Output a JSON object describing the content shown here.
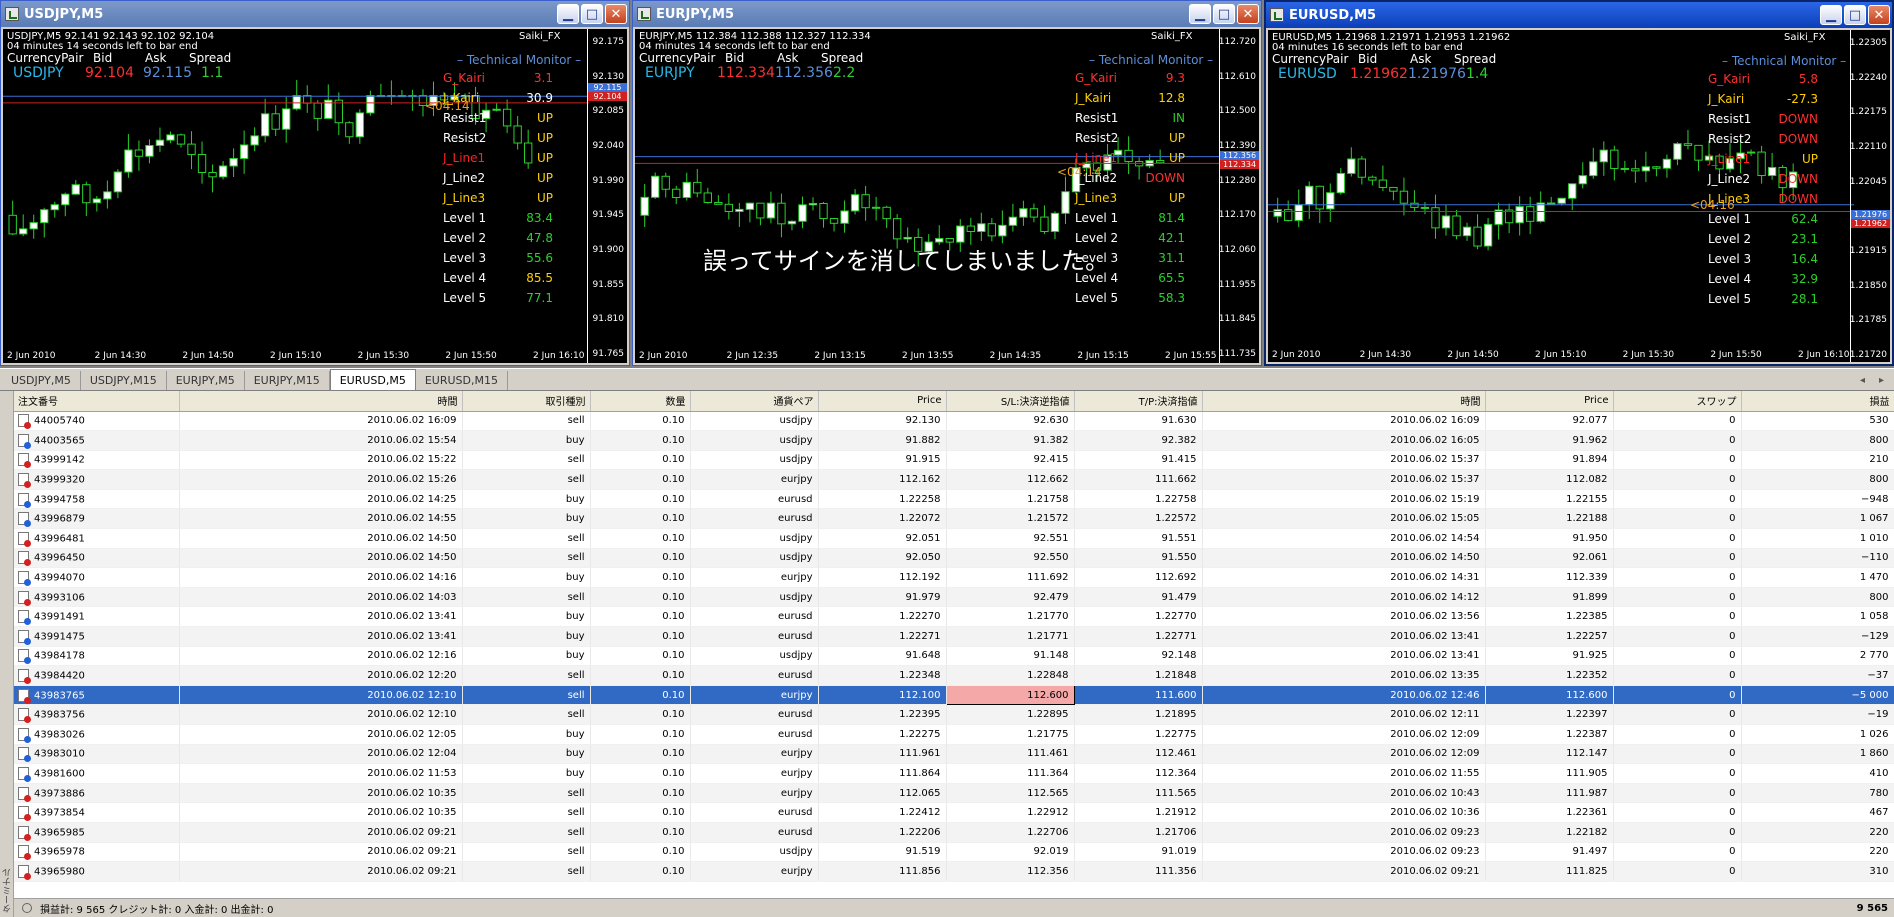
{
  "windows": [
    {
      "id": "w1",
      "title": "USDJPY,M5",
      "info_line1": "USDJPY,M5  92.141 92.143 92.102 92.104",
      "info_line2": "04 minutes 14 seconds left to bar end",
      "brand": "Saiki_FX",
      "hdr": {
        "pair_label": "CurrencyPair",
        "bid_label": "Bid",
        "ask_label": "Ask",
        "spread_label": "Spread",
        "pair": "USDJPY",
        "bid": "92.104",
        "ask": "92.115",
        "spread": "1.1"
      },
      "monitor_title": "– Technical  Monitor –",
      "monitor": [
        {
          "label": "G_Kairi",
          "value": "3.1",
          "lc": "#ff3030",
          "vc": "#ff3030"
        },
        {
          "label": "J_Kairi",
          "value": "30.9",
          "lc": "#ffd000",
          "vc": "#ffffff"
        },
        {
          "label": "Resist1",
          "value": "UP",
          "lc": "#ffffff",
          "vc": "#ffd000"
        },
        {
          "label": "Resist2",
          "value": "UP",
          "lc": "#ffffff",
          "vc": "#ffd000"
        },
        {
          "label": "J_Line1",
          "value": "UP",
          "lc": "#ff2020",
          "vc": "#ffd000"
        },
        {
          "label": "J_Line2",
          "value": "UP",
          "lc": "#ffffff",
          "vc": "#ffd000"
        },
        {
          "label": "J_Line3",
          "value": "UP",
          "lc": "#ffd000",
          "vc": "#ffd000"
        },
        {
          "label": "Level 1",
          "value": "83.4",
          "lc": "#ffffff",
          "vc": "#2bd12b"
        },
        {
          "label": "Level 2",
          "value": "47.8",
          "lc": "#ffffff",
          "vc": "#2bd12b"
        },
        {
          "label": "Level 3",
          "value": "55.6",
          "lc": "#ffffff",
          "vc": "#2bd12b"
        },
        {
          "label": "Level 4",
          "value": "85.5",
          "lc": "#ffffff",
          "vc": "#ffd000"
        },
        {
          "label": "Level 5",
          "value": "77.1",
          "lc": "#ffffff",
          "vc": "#2bd12b"
        }
      ],
      "prices": [
        "92.175",
        "92.130",
        "92.085",
        "92.040",
        "91.990",
        "91.945",
        "91.900",
        "91.855",
        "91.810",
        "91.765"
      ],
      "current_tags": [
        "92.115",
        "92.104"
      ],
      "times": [
        "2 Jun 2010",
        "2 Jun 14:30",
        "2 Jun 14:50",
        "2 Jun 15:10",
        "2 Jun 15:30",
        "2 Jun 15:50",
        "2 Jun 16:10"
      ],
      "countdown": "<04:14",
      "note": ""
    },
    {
      "id": "w2",
      "title": "EURJPY,M5",
      "info_line1": "EURJPY,M5  112.384 112.388 112.327 112.334",
      "info_line2": "04 minutes 14 seconds left to bar end",
      "brand": "Saiki_FX",
      "hdr": {
        "pair_label": "CurrencyPair",
        "bid_label": "Bid",
        "ask_label": "Ask",
        "spread_label": "Spread",
        "pair": "EURJPY",
        "bid": "112.334",
        "ask": "112.356",
        "spread": "2.2"
      },
      "monitor_title": "– Technical  Monitor –",
      "monitor": [
        {
          "label": "G_Kairi",
          "value": "9.3",
          "lc": "#ff3030",
          "vc": "#ff3030"
        },
        {
          "label": "J_Kairi",
          "value": "12.8",
          "lc": "#ffd000",
          "vc": "#ffd000"
        },
        {
          "label": "Resist1",
          "value": "IN",
          "lc": "#ffffff",
          "vc": "#2bd12b"
        },
        {
          "label": "Resist2",
          "value": "UP",
          "lc": "#ffffff",
          "vc": "#ffd000"
        },
        {
          "label": "J_Line1",
          "value": "UP",
          "lc": "#ff2020",
          "vc": "#ffd000"
        },
        {
          "label": "J_Line2",
          "value": "DOWN",
          "lc": "#ffffff",
          "vc": "#ff3030"
        },
        {
          "label": "J_Line3",
          "value": "UP",
          "lc": "#ffd000",
          "vc": "#ffd000"
        },
        {
          "label": "Level 1",
          "value": "81.4",
          "lc": "#ffffff",
          "vc": "#2bd12b"
        },
        {
          "label": "Level 2",
          "value": "42.1",
          "lc": "#ffffff",
          "vc": "#2bd12b"
        },
        {
          "label": "Level 3",
          "value": "31.1",
          "lc": "#ffffff",
          "vc": "#2bd12b"
        },
        {
          "label": "Level 4",
          "value": "65.5",
          "lc": "#ffffff",
          "vc": "#2bd12b"
        },
        {
          "label": "Level 5",
          "value": "58.3",
          "lc": "#ffffff",
          "vc": "#2bd12b"
        }
      ],
      "prices": [
        "112.720",
        "112.610",
        "112.500",
        "112.390",
        "112.280",
        "112.170",
        "112.060",
        "111.955",
        "111.845",
        "111.735"
      ],
      "current_tags": [
        "112.356",
        "112.334"
      ],
      "times": [
        "2 Jun 2010",
        "2 Jun 12:35",
        "2 Jun 13:15",
        "2 Jun 13:55",
        "2 Jun 14:35",
        "2 Jun 15:15",
        "2 Jun 15:55"
      ],
      "countdown": "<04:14",
      "note": "誤ってサインを消してしまいました。"
    },
    {
      "id": "w3",
      "title": "EURUSD,M5",
      "info_line1": "EURUSD,M5  1.21968 1.21971 1.21953 1.21962",
      "info_line2": "04 minutes 16 seconds left to bar end",
      "brand": "Saiki_FX",
      "hdr": {
        "pair_label": "CurrencyPair",
        "bid_label": "Bid",
        "ask_label": "Ask",
        "spread_label": "Spread",
        "pair": "EURUSD",
        "bid": "1.21962",
        "ask": "1.21976",
        "spread": "1.4"
      },
      "monitor_title": "– Technical  Monitor –",
      "monitor": [
        {
          "label": "G_Kairi",
          "value": "5.8",
          "lc": "#ff3030",
          "vc": "#ff3030"
        },
        {
          "label": "J_Kairi",
          "value": "-27.3",
          "lc": "#ffd000",
          "vc": "#ffd000"
        },
        {
          "label": "Resist1",
          "value": "DOWN",
          "lc": "#ffffff",
          "vc": "#ff3030"
        },
        {
          "label": "Resist2",
          "value": "DOWN",
          "lc": "#ffffff",
          "vc": "#ff3030"
        },
        {
          "label": "J_Line1",
          "value": "UP",
          "lc": "#ff2020",
          "vc": "#ffd000"
        },
        {
          "label": "J_Line2",
          "value": "DOWN",
          "lc": "#ffffff",
          "vc": "#ff3030"
        },
        {
          "label": "J_Line3",
          "value": "DOWN",
          "lc": "#ffd000",
          "vc": "#ff3030"
        },
        {
          "label": "Level 1",
          "value": "62.4",
          "lc": "#ffffff",
          "vc": "#2bd12b"
        },
        {
          "label": "Level 2",
          "value": "23.1",
          "lc": "#ffffff",
          "vc": "#2bd12b"
        },
        {
          "label": "Level 3",
          "value": "16.4",
          "lc": "#ffffff",
          "vc": "#2bd12b"
        },
        {
          "label": "Level 4",
          "value": "32.9",
          "lc": "#ffffff",
          "vc": "#2bd12b"
        },
        {
          "label": "Level 5",
          "value": "28.1",
          "lc": "#ffffff",
          "vc": "#2bd12b"
        }
      ],
      "prices": [
        "1.22305",
        "1.22240",
        "1.22175",
        "1.22110",
        "1.22045",
        "1.21980",
        "1.21915",
        "1.21850",
        "1.21785",
        "1.21720"
      ],
      "current_tags": [
        "1.21976",
        "1.21962"
      ],
      "times": [
        "2 Jun 2010",
        "2 Jun 14:30",
        "2 Jun 14:50",
        "2 Jun 15:10",
        "2 Jun 15:30",
        "2 Jun 15:50",
        "2 Jun 16:10"
      ],
      "countdown": "<04:16",
      "note": ""
    }
  ],
  "tabs": [
    "USDJPY,M5",
    "USDJPY,M15",
    "EURJPY,M5",
    "EURJPY,M15",
    "EURUSD,M5",
    "EURUSD,M15"
  ],
  "active_tab": "EURUSD,M5",
  "columns": [
    "注文番号",
    "時間",
    "取引種別",
    "数量",
    "通貨ペア",
    "Price",
    "S/L:決済逆指値",
    "T/P:決済指値",
    "時間",
    "Price",
    "スワップ",
    "損益"
  ],
  "orders": [
    [
      "44005740",
      "2010.06.02 16:09",
      "sell",
      "0.10",
      "usdjpy",
      "92.130",
      "92.630",
      "91.630",
      "2010.06.02 16:09",
      "92.077",
      "0",
      "530"
    ],
    [
      "44003565",
      "2010.06.02 15:54",
      "buy",
      "0.10",
      "usdjpy",
      "91.882",
      "91.382",
      "92.382",
      "2010.06.02 16:05",
      "91.962",
      "0",
      "800"
    ],
    [
      "43999142",
      "2010.06.02 15:22",
      "sell",
      "0.10",
      "usdjpy",
      "91.915",
      "92.415",
      "91.415",
      "2010.06.02 15:37",
      "91.894",
      "0",
      "210"
    ],
    [
      "43999320",
      "2010.06.02 15:26",
      "sell",
      "0.10",
      "eurjpy",
      "112.162",
      "112.662",
      "111.662",
      "2010.06.02 15:37",
      "112.082",
      "0",
      "800"
    ],
    [
      "43994758",
      "2010.06.02 14:25",
      "buy",
      "0.10",
      "eurusd",
      "1.22258",
      "1.21758",
      "1.22758",
      "2010.06.02 15:19",
      "1.22155",
      "0",
      "−948"
    ],
    [
      "43996879",
      "2010.06.02 14:55",
      "buy",
      "0.10",
      "eurusd",
      "1.22072",
      "1.21572",
      "1.22572",
      "2010.06.02 15:05",
      "1.22188",
      "0",
      "1 067"
    ],
    [
      "43996481",
      "2010.06.02 14:50",
      "sell",
      "0.10",
      "usdjpy",
      "92.051",
      "92.551",
      "91.551",
      "2010.06.02 14:54",
      "91.950",
      "0",
      "1 010"
    ],
    [
      "43996450",
      "2010.06.02 14:50",
      "sell",
      "0.10",
      "usdjpy",
      "92.050",
      "92.550",
      "91.550",
      "2010.06.02 14:50",
      "92.061",
      "0",
      "−110"
    ],
    [
      "43994070",
      "2010.06.02 14:16",
      "buy",
      "0.10",
      "eurjpy",
      "112.192",
      "111.692",
      "112.692",
      "2010.06.02 14:31",
      "112.339",
      "0",
      "1 470"
    ],
    [
      "43993106",
      "2010.06.02 14:03",
      "sell",
      "0.10",
      "usdjpy",
      "91.979",
      "92.479",
      "91.479",
      "2010.06.02 14:12",
      "91.899",
      "0",
      "800"
    ],
    [
      "43991491",
      "2010.06.02 13:41",
      "buy",
      "0.10",
      "eurusd",
      "1.22270",
      "1.21770",
      "1.22770",
      "2010.06.02 13:56",
      "1.22385",
      "0",
      "1 058"
    ],
    [
      "43991475",
      "2010.06.02 13:41",
      "buy",
      "0.10",
      "eurusd",
      "1.22271",
      "1.21771",
      "1.22771",
      "2010.06.02 13:41",
      "1.22257",
      "0",
      "−129"
    ],
    [
      "43984178",
      "2010.06.02 12:16",
      "buy",
      "0.10",
      "usdjpy",
      "91.648",
      "91.148",
      "92.148",
      "2010.06.02 13:41",
      "91.925",
      "0",
      "2 770"
    ],
    [
      "43984420",
      "2010.06.02 12:20",
      "sell",
      "0.10",
      "eurusd",
      "1.22348",
      "1.22848",
      "1.21848",
      "2010.06.02 13:35",
      "1.22352",
      "0",
      "−37"
    ],
    [
      "43983765",
      "2010.06.02 12:10",
      "sell",
      "0.10",
      "eurjpy",
      "112.100",
      "112.600",
      "111.600",
      "2010.06.02 12:46",
      "112.600",
      "0",
      "−5 000"
    ],
    [
      "43983756",
      "2010.06.02 12:10",
      "sell",
      "0.10",
      "eurusd",
      "1.22395",
      "1.22895",
      "1.21895",
      "2010.06.02 12:11",
      "1.22397",
      "0",
      "−19"
    ],
    [
      "43983026",
      "2010.06.02 12:05",
      "buy",
      "0.10",
      "eurusd",
      "1.22275",
      "1.21775",
      "1.22775",
      "2010.06.02 12:09",
      "1.22387",
      "0",
      "1 026"
    ],
    [
      "43983010",
      "2010.06.02 12:04",
      "buy",
      "0.10",
      "eurjpy",
      "111.961",
      "111.461",
      "112.461",
      "2010.06.02 12:09",
      "112.147",
      "0",
      "1 860"
    ],
    [
      "43981600",
      "2010.06.02 11:53",
      "buy",
      "0.10",
      "eurjpy",
      "111.864",
      "111.364",
      "112.364",
      "2010.06.02 11:55",
      "111.905",
      "0",
      "410"
    ],
    [
      "43973886",
      "2010.06.02 10:35",
      "sell",
      "0.10",
      "eurjpy",
      "112.065",
      "112.565",
      "111.565",
      "2010.06.02 10:43",
      "111.987",
      "0",
      "780"
    ],
    [
      "43973854",
      "2010.06.02 10:35",
      "sell",
      "0.10",
      "eurusd",
      "1.22412",
      "1.22912",
      "1.21912",
      "2010.06.02 10:36",
      "1.22361",
      "0",
      "467"
    ],
    [
      "43965985",
      "2010.06.02 09:21",
      "sell",
      "0.10",
      "eurusd",
      "1.22206",
      "1.22706",
      "1.21706",
      "2010.06.02 09:23",
      "1.22182",
      "0",
      "220"
    ],
    [
      "43965978",
      "2010.06.02 09:21",
      "sell",
      "0.10",
      "usdjpy",
      "91.519",
      "92.019",
      "91.019",
      "2010.06.02 09:23",
      "91.497",
      "0",
      "220"
    ],
    [
      "43965980",
      "2010.06.02 09:21",
      "sell",
      "0.10",
      "eurjpy",
      "111.856",
      "112.356",
      "111.356",
      "2010.06.02 09:21",
      "111.825",
      "0",
      "310"
    ]
  ],
  "selected_order": "43983765",
  "status": {
    "text": "損益計: 9 565  クレジット計: 0  入金計: 0  出金計: 0",
    "total": "9 565"
  },
  "side_label": "ターミナル"
}
